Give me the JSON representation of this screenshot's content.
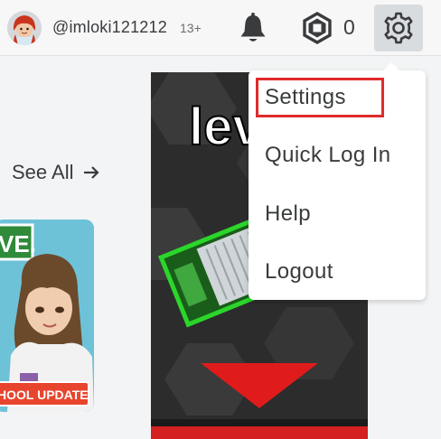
{
  "header": {
    "username": "@imloki121212",
    "age_badge": "13+",
    "robux_count": "0"
  },
  "icons": {
    "notifications": "bell-icon",
    "robux": "robux-icon",
    "settings": "gear-icon",
    "see_all_arrow": "arrow-right-icon"
  },
  "colors": {
    "highlight": "#e02b2b",
    "text": "#393b3d"
  },
  "main": {
    "see_all": "See All"
  },
  "game_card": {
    "sign_text": "VE.",
    "banner_text": "HOOL UPDATE"
  },
  "ad": {
    "headline": "lev"
  },
  "menu": {
    "items": [
      {
        "label": "Settings",
        "highlighted": true
      },
      {
        "label": "Quick Log In",
        "highlighted": false
      },
      {
        "label": "Help",
        "highlighted": false
      },
      {
        "label": "Logout",
        "highlighted": false
      }
    ]
  }
}
